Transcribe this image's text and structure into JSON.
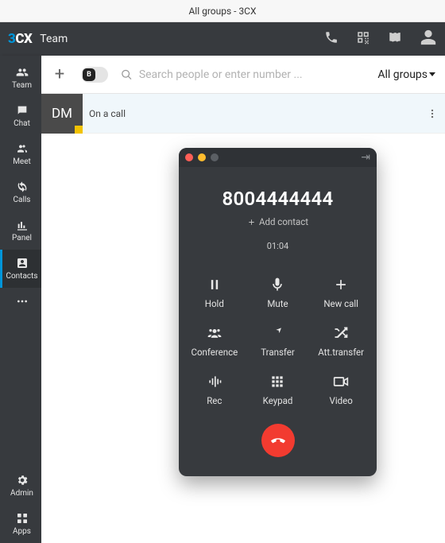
{
  "window": {
    "title": "All groups - 3CX"
  },
  "topbar": {
    "brand_3": "3",
    "brand_cx": "CX",
    "title": "Team"
  },
  "sidebar": {
    "items": [
      {
        "key": "team",
        "label": "Team"
      },
      {
        "key": "chat",
        "label": "Chat"
      },
      {
        "key": "meet",
        "label": "Meet"
      },
      {
        "key": "calls",
        "label": "Calls"
      },
      {
        "key": "panel",
        "label": "Panel"
      },
      {
        "key": "contacts",
        "label": "Contacts"
      },
      {
        "key": "more",
        "label": "..."
      }
    ],
    "bottom": [
      {
        "key": "admin",
        "label": "Admin"
      },
      {
        "key": "apps",
        "label": "Apps"
      }
    ]
  },
  "toolbar": {
    "toggle_label": "B",
    "search_placeholder": "Search people or enter number ...",
    "groups_label": "All groups"
  },
  "contacts": [
    {
      "initials": "DM",
      "status": "On a call",
      "status_color": "#f2c200",
      "selected": true
    }
  ],
  "call": {
    "number": "8004444444",
    "add_contact_label": "Add contact",
    "timer": "01:04",
    "actions": [
      {
        "key": "hold",
        "label": "Hold"
      },
      {
        "key": "mute",
        "label": "Mute"
      },
      {
        "key": "newcall",
        "label": "New call"
      },
      {
        "key": "conference",
        "label": "Conference"
      },
      {
        "key": "transfer",
        "label": "Transfer"
      },
      {
        "key": "atttransfer",
        "label": "Att.transfer"
      },
      {
        "key": "rec",
        "label": "Rec"
      },
      {
        "key": "keypad",
        "label": "Keypad"
      },
      {
        "key": "video",
        "label": "Video"
      }
    ]
  }
}
